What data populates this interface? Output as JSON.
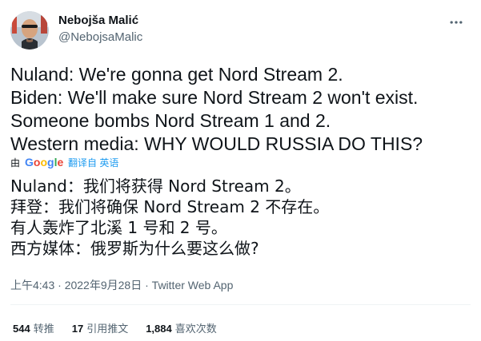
{
  "author": {
    "name": "Nebojša Malić",
    "handle": "@NebojsaMalic"
  },
  "tweet": {
    "lines": [
      "Nuland: We're gonna get Nord Stream 2.",
      "Biden: We'll make sure Nord Stream 2 won't exist.",
      "Someone bombs Nord Stream 1 and 2.",
      "Western media: WHY WOULD RUSSIA DO THIS?"
    ]
  },
  "translation": {
    "by_label": "由",
    "provider": "Google",
    "link_label": "翻译自 英语",
    "lines": [
      "Nuland：我们将获得 Nord Stream 2。",
      "拜登：我们将确保 Nord Stream 2 不存在。",
      "有人轰炸了北溪 1 号和 2 号。",
      "西方媒体：俄罗斯为什么要这么做?"
    ]
  },
  "meta": {
    "time": "上午4:43",
    "separator": " · ",
    "date": "2022年9月28日",
    "source": "Twitter Web App"
  },
  "stats": [
    {
      "num": "544",
      "label": "转推"
    },
    {
      "num": "17",
      "label": "引用推文"
    },
    {
      "num": "1,884",
      "label": "喜欢次数"
    }
  ],
  "icons": {
    "more": "more-options-icon",
    "avatar": "profile-avatar"
  },
  "colors": {
    "text": "#0f1419",
    "secondary": "#536471",
    "link": "#1d9bf0",
    "divider": "#eff3f4"
  }
}
